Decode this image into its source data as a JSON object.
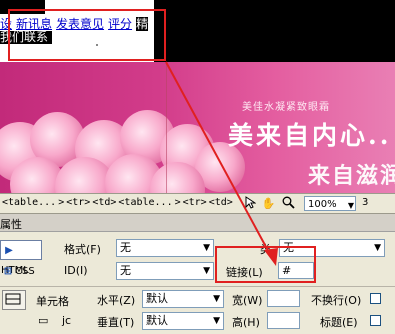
{
  "design": {
    "nav_links": [
      "设",
      "新讯息",
      "发表意见",
      "评分",
      "精"
    ],
    "nav_line2": "我们联系",
    "banner_subtitle": "美佳水凝紧致眼霜",
    "banner_title": "美来自内心..",
    "banner_title2": "来自滋润"
  },
  "tag_selector": {
    "tags": [
      "<table...",
      ">",
      "<tr>",
      "<td>",
      "<table...",
      ">",
      "<tr>",
      "<td>"
    ],
    "zoom": "100%",
    "dims_partial": "3"
  },
  "properties": {
    "title": "属性",
    "mode_html": "HTML",
    "mode_css": "CSS",
    "format_label": "格式(F)",
    "format_value": "无",
    "class_label": "类",
    "class_value": "无",
    "id_label": "ID(I)",
    "id_value": "无",
    "link_label": "链接(L)",
    "link_value": "#",
    "cell_label": "单元格",
    "horz_label": "水平(Z)",
    "horz_value": "默认",
    "vert_label": "垂直(T)",
    "vert_value": "默认",
    "width_label": "宽(W)",
    "height_label": "高(H)",
    "nowrap_label": "不换行(O)",
    "header_label": "标题(E)",
    "split_label": "jc"
  },
  "colors": {
    "highlight": "#e02020",
    "link": "#0000cc",
    "banner": "#d23c8a"
  }
}
